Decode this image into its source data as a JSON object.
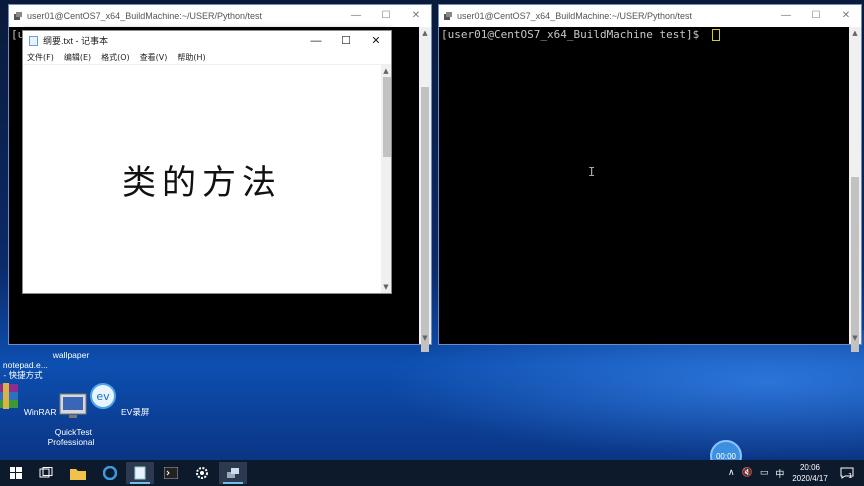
{
  "terminal_left": {
    "title": "user01@CentOS7_x64_BuildMachine:~/USER/Python/test",
    "prompt_fragment": "[u                          test]$ "
  },
  "terminal_right": {
    "title": "user01@CentOS7_x64_BuildMachine:~/USER/Python/test",
    "prompt": "[user01@CentOS7_x64_BuildMachine test]$ "
  },
  "notepad": {
    "title": "纲要.txt - 记事本",
    "menu": [
      "文件(F)",
      "编辑(E)",
      "格式(O)",
      "查看(V)",
      "帮助(H)"
    ],
    "content": "类的方法"
  },
  "window_buttons": {
    "minimize": "—",
    "maximize": "☐",
    "close": "✕"
  },
  "desktop_icons": [
    {
      "label": "notepad.e...\n- 快捷方式",
      "icon": "notepad-shortcut-icon"
    },
    {
      "label": "wallpaper",
      "icon": "folder-icon"
    },
    {
      "label": "WinRAR",
      "icon": "winrar-icon"
    },
    {
      "label": "QuickTest\nProfessional",
      "icon": "quicktest-icon"
    },
    {
      "label": "EV录屏",
      "icon": "ev-recorder-icon"
    }
  ],
  "taskbar": {
    "apps": [
      "start-icon",
      "task-view-icon",
      "file-explorer-icon",
      "edge-icon",
      "notepad-icon",
      "terminal-icon",
      "settings-icon",
      "network-tool-icon"
    ],
    "tray": {
      "ime": "中",
      "notification_count": "1"
    },
    "clock": {
      "time": "20:06",
      "date": "2020/4/17"
    }
  },
  "recorder_timer": "00:00",
  "colors": {
    "terminal_bg": "#000000",
    "taskbar_bg": "#0d1a2c",
    "accent": "#3d8fe0"
  }
}
